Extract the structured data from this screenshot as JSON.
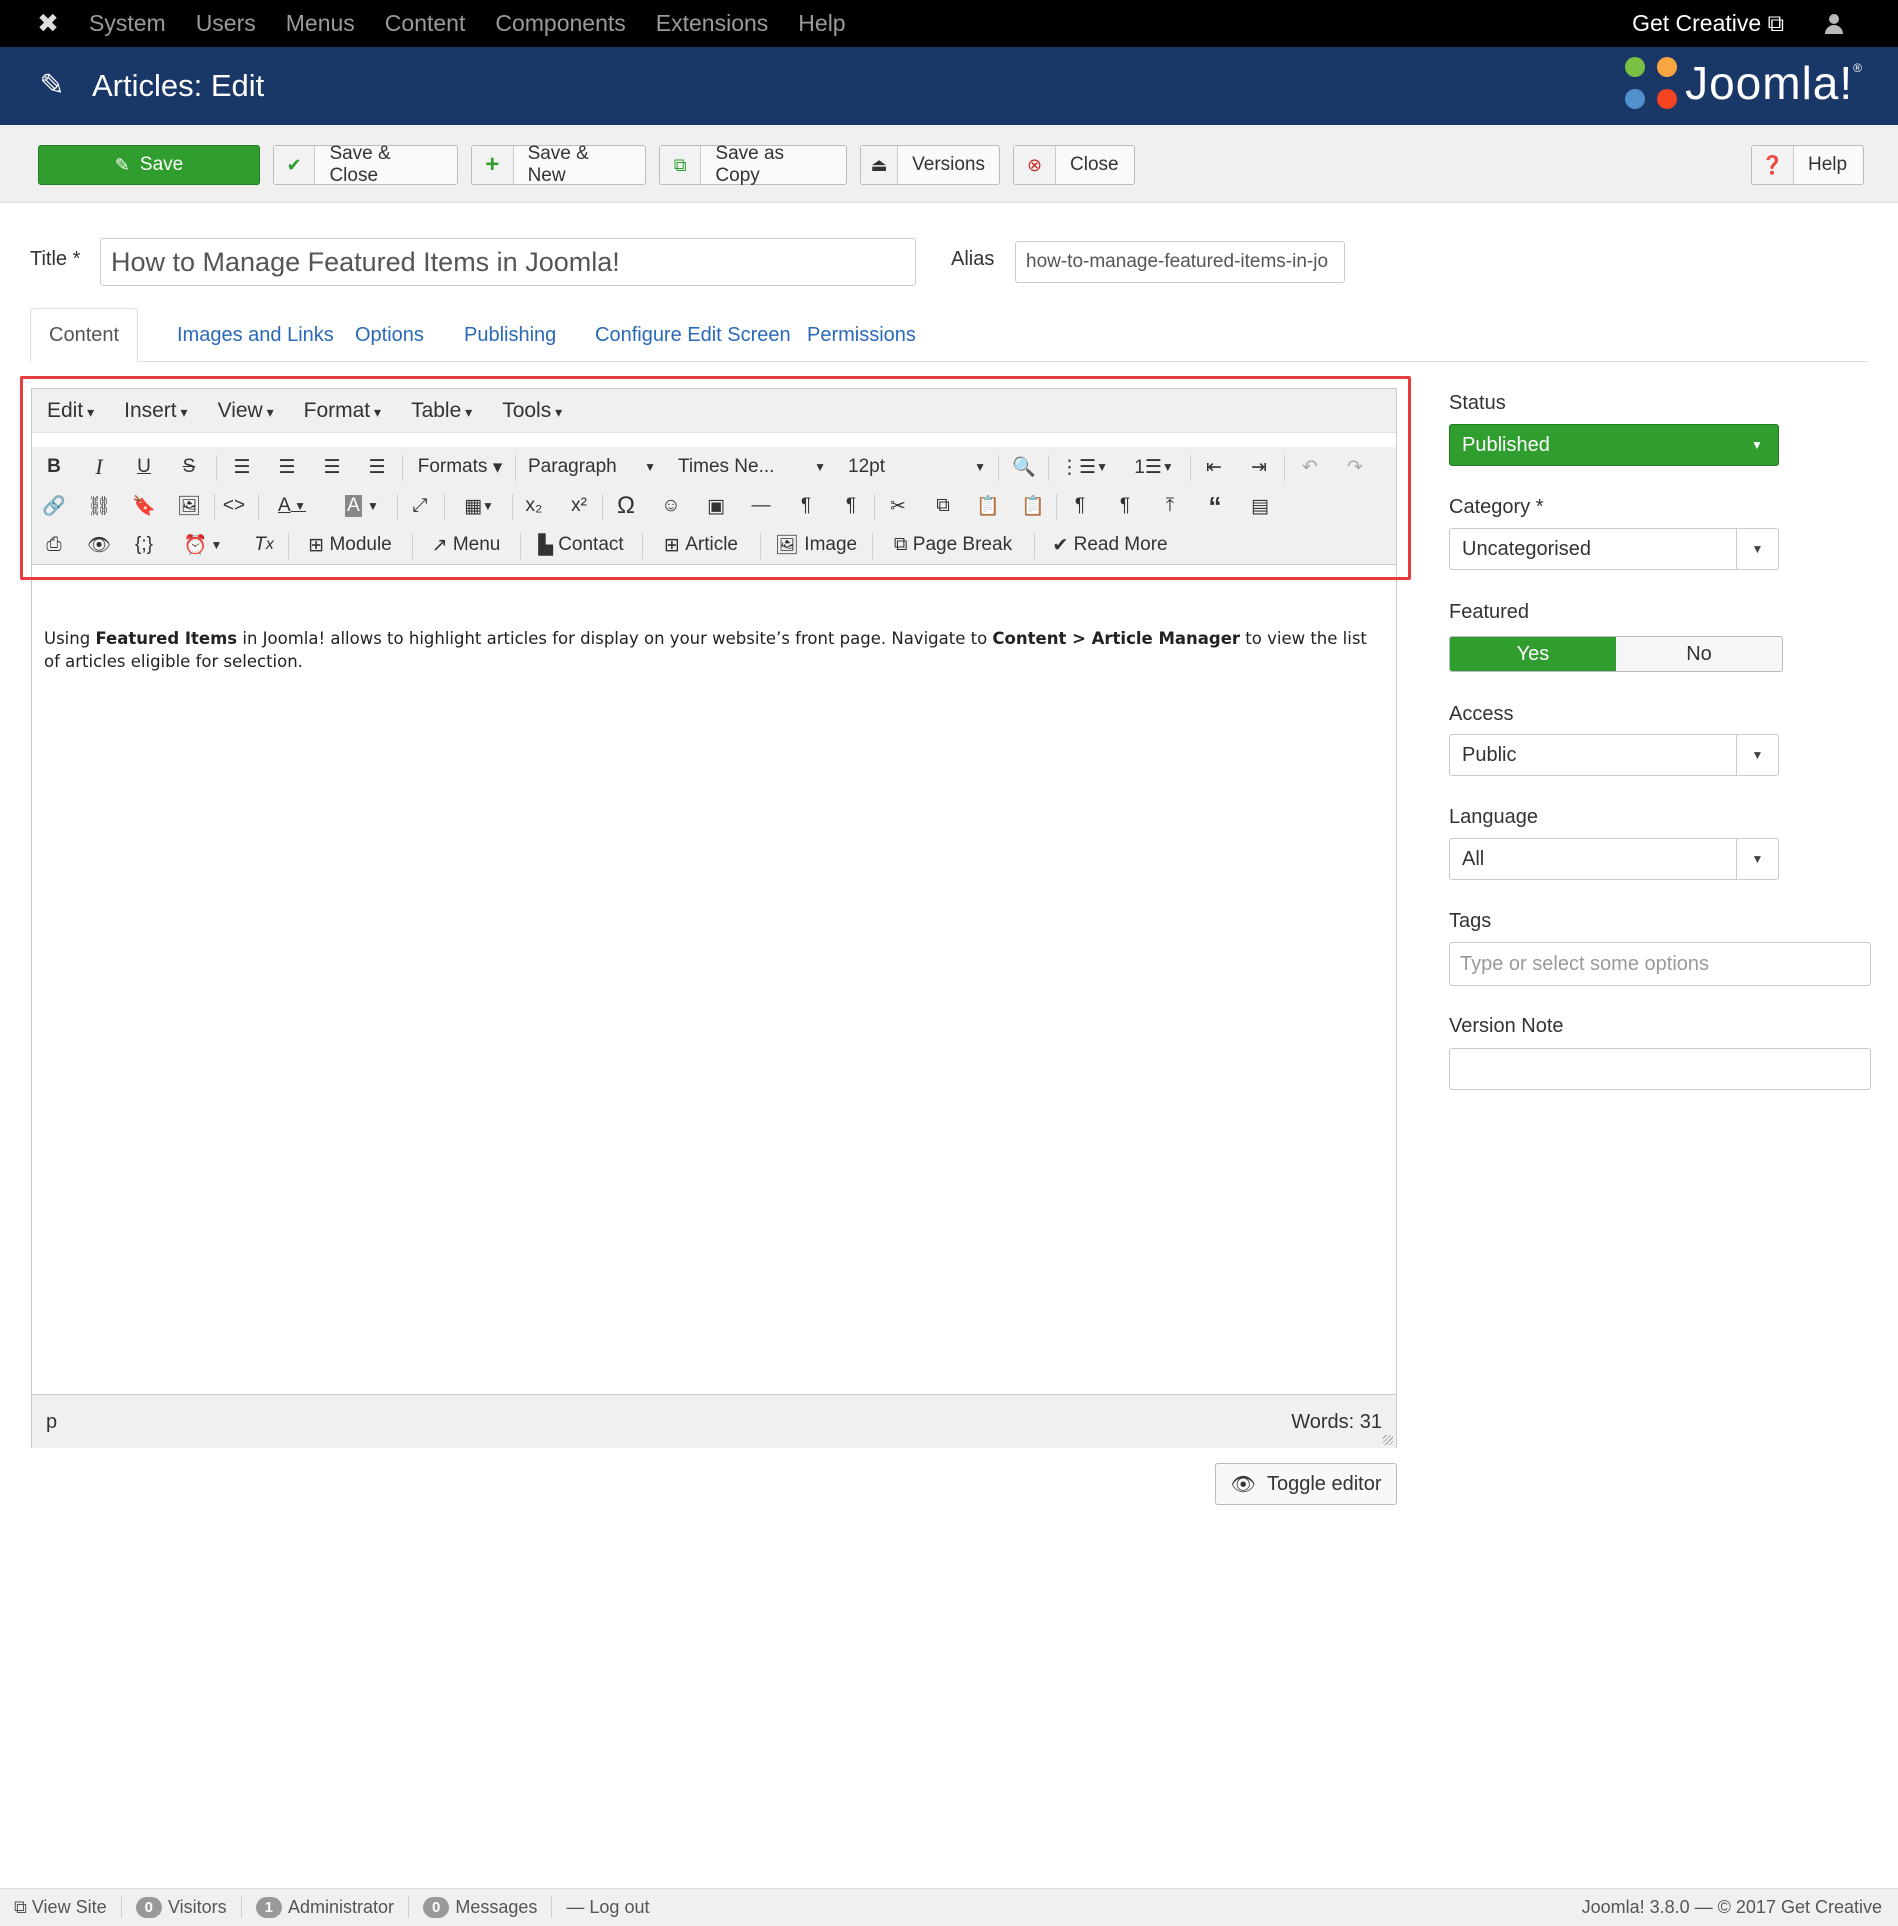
{
  "topnav": {
    "menu": [
      "System",
      "Users",
      "Menus",
      "Content",
      "Components",
      "Extensions",
      "Help"
    ],
    "get_creative": "Get Creative ⧉"
  },
  "header": {
    "title": "Articles: Edit",
    "brand": "Joomla!",
    "brand_reg": "®"
  },
  "toolbar": {
    "save": "Save",
    "save_close": "Save & Close",
    "save_new": "Save & New",
    "save_copy": "Save as Copy",
    "versions": "Versions",
    "close": "Close",
    "help": "Help"
  },
  "form": {
    "title_label": "Title *",
    "title_value": "How to Manage Featured Items in Joomla!",
    "alias_label": "Alias",
    "alias_value": "how-to-manage-featured-items-in-jo"
  },
  "tabs": [
    "Content",
    "Images and Links",
    "Options",
    "Publishing",
    "Configure Edit Screen",
    "Permissions"
  ],
  "editor": {
    "menubar": [
      "Edit",
      "Insert",
      "View",
      "Format",
      "Table",
      "Tools"
    ],
    "formats": "Formats",
    "block": "Paragraph",
    "font": "Times Ne...",
    "size": "12pt",
    "buttons": {
      "module": "Module",
      "menu": "Menu",
      "contact": "Contact",
      "article": "Article",
      "image": "Image",
      "pagebreak": "Page Break",
      "readmore": "Read More"
    },
    "content": {
      "p1": "Using ",
      "b1": "Featured Items",
      "p2": " in Joomla! allows to highlight articles for display on your website’s front page. Navigate to ",
      "b2": "Content > Article Manager",
      "p3": " to view the list of articles eligible for selection."
    },
    "path": "p",
    "words": "Words: 31",
    "toggle": "Toggle editor"
  },
  "sidebar": {
    "status_label": "Status",
    "status_value": "Published",
    "category_label": "Category *",
    "category_value": "Uncategorised",
    "featured_label": "Featured",
    "featured_yes": "Yes",
    "featured_no": "No",
    "access_label": "Access",
    "access_value": "Public",
    "language_label": "Language",
    "language_value": "All",
    "tags_label": "Tags",
    "tags_placeholder": "Type or select some options",
    "version_label": "Version Note",
    "version_value": ""
  },
  "footer": {
    "view_site": "View Site",
    "visitors_count": "0",
    "visitors": "Visitors",
    "admin_count": "1",
    "admin": "Administrator",
    "messages_count": "0",
    "messages": "Messages",
    "logout": "Log out",
    "copyright": "Joomla! 3.8.0  —  © 2017 Get Creative"
  },
  "colors": {
    "topnav_bg": "#000000",
    "header_bg": "#1a3867",
    "success_green": "#2f9e2f",
    "link_blue": "#2a69b8",
    "highlight_red": "#e43e3e"
  }
}
